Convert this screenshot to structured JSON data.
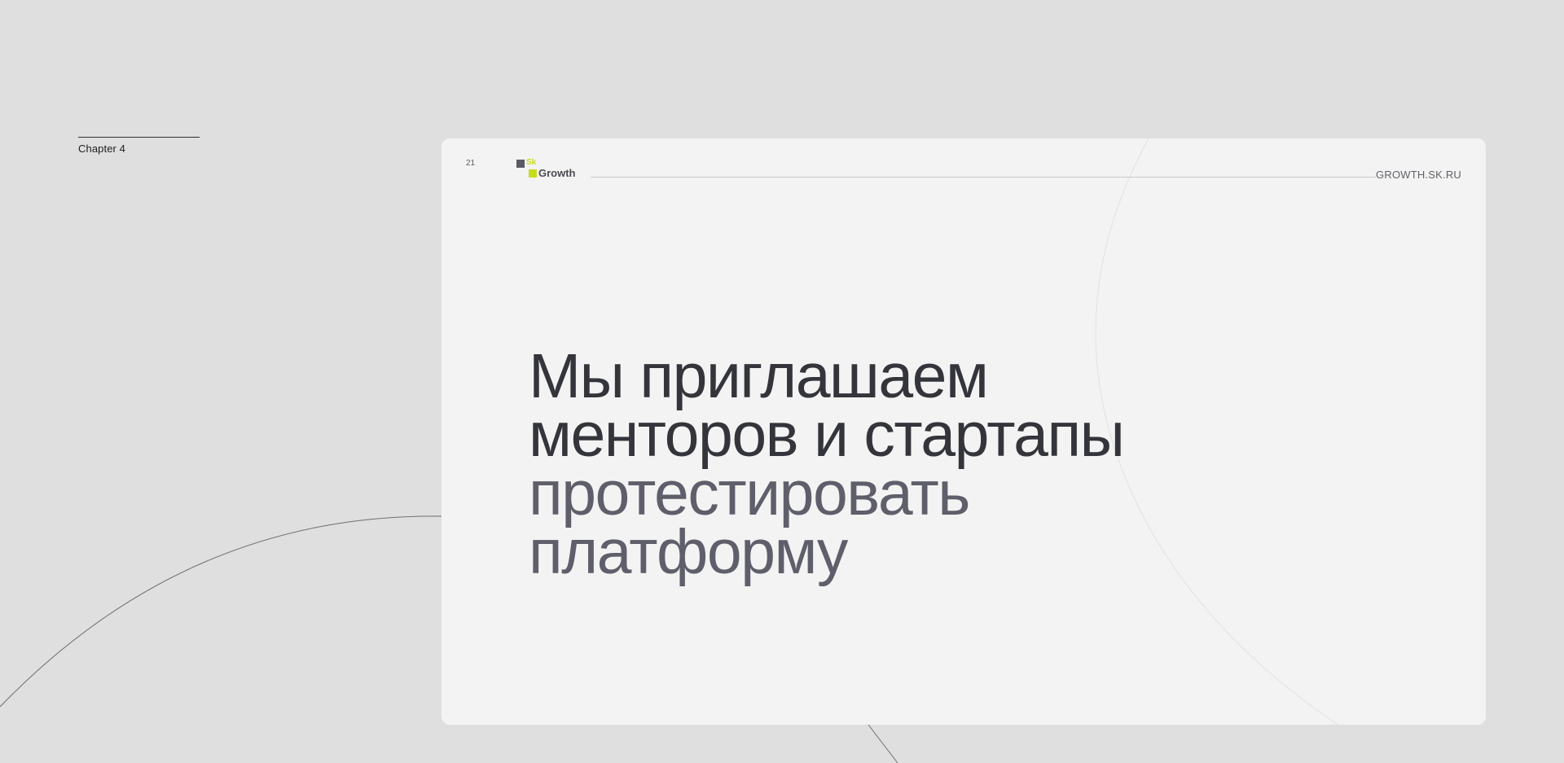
{
  "chapter": {
    "label": "Chapter 4"
  },
  "slide": {
    "page_number": "21",
    "logo": {
      "sk": "Sk",
      "wordmark": "Growth",
      "brand_colors": {
        "lime": "#c8dc1e",
        "dark": "#5a5b62"
      }
    },
    "url": "GROWTH.SK.RU",
    "headline": {
      "line_1": "Мы приглашаем",
      "line_2": "менторов и стартапы",
      "line_3": "протестировать",
      "line_4": "платформу"
    },
    "colors": {
      "headline_primary": "#34353b",
      "headline_secondary": "#5e5f6a",
      "background": "#f3f3f3"
    }
  }
}
